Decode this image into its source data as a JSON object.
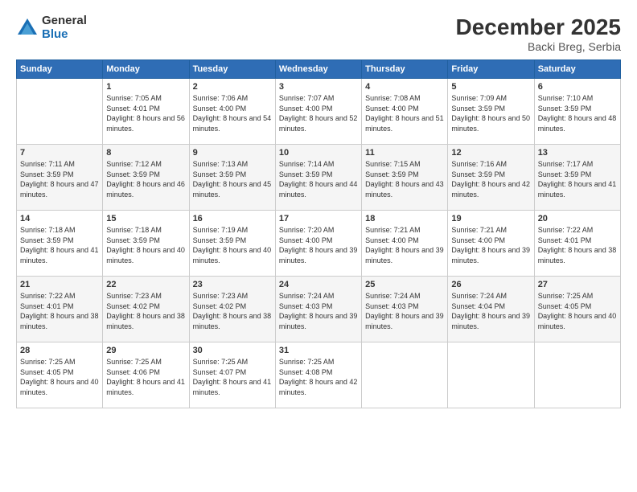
{
  "header": {
    "logo_general": "General",
    "logo_blue": "Blue",
    "title": "December 2025",
    "location": "Backi Breg, Serbia"
  },
  "days_of_week": [
    "Sunday",
    "Monday",
    "Tuesday",
    "Wednesday",
    "Thursday",
    "Friday",
    "Saturday"
  ],
  "weeks": [
    [
      {
        "day": "",
        "empty": true
      },
      {
        "day": "1",
        "sunrise": "Sunrise: 7:05 AM",
        "sunset": "Sunset: 4:01 PM",
        "daylight": "Daylight: 8 hours and 56 minutes."
      },
      {
        "day": "2",
        "sunrise": "Sunrise: 7:06 AM",
        "sunset": "Sunset: 4:00 PM",
        "daylight": "Daylight: 8 hours and 54 minutes."
      },
      {
        "day": "3",
        "sunrise": "Sunrise: 7:07 AM",
        "sunset": "Sunset: 4:00 PM",
        "daylight": "Daylight: 8 hours and 52 minutes."
      },
      {
        "day": "4",
        "sunrise": "Sunrise: 7:08 AM",
        "sunset": "Sunset: 4:00 PM",
        "daylight": "Daylight: 8 hours and 51 minutes."
      },
      {
        "day": "5",
        "sunrise": "Sunrise: 7:09 AM",
        "sunset": "Sunset: 3:59 PM",
        "daylight": "Daylight: 8 hours and 50 minutes."
      },
      {
        "day": "6",
        "sunrise": "Sunrise: 7:10 AM",
        "sunset": "Sunset: 3:59 PM",
        "daylight": "Daylight: 8 hours and 48 minutes."
      }
    ],
    [
      {
        "day": "7",
        "sunrise": "Sunrise: 7:11 AM",
        "sunset": "Sunset: 3:59 PM",
        "daylight": "Daylight: 8 hours and 47 minutes."
      },
      {
        "day": "8",
        "sunrise": "Sunrise: 7:12 AM",
        "sunset": "Sunset: 3:59 PM",
        "daylight": "Daylight: 8 hours and 46 minutes."
      },
      {
        "day": "9",
        "sunrise": "Sunrise: 7:13 AM",
        "sunset": "Sunset: 3:59 PM",
        "daylight": "Daylight: 8 hours and 45 minutes."
      },
      {
        "day": "10",
        "sunrise": "Sunrise: 7:14 AM",
        "sunset": "Sunset: 3:59 PM",
        "daylight": "Daylight: 8 hours and 44 minutes."
      },
      {
        "day": "11",
        "sunrise": "Sunrise: 7:15 AM",
        "sunset": "Sunset: 3:59 PM",
        "daylight": "Daylight: 8 hours and 43 minutes."
      },
      {
        "day": "12",
        "sunrise": "Sunrise: 7:16 AM",
        "sunset": "Sunset: 3:59 PM",
        "daylight": "Daylight: 8 hours and 42 minutes."
      },
      {
        "day": "13",
        "sunrise": "Sunrise: 7:17 AM",
        "sunset": "Sunset: 3:59 PM",
        "daylight": "Daylight: 8 hours and 41 minutes."
      }
    ],
    [
      {
        "day": "14",
        "sunrise": "Sunrise: 7:18 AM",
        "sunset": "Sunset: 3:59 PM",
        "daylight": "Daylight: 8 hours and 41 minutes."
      },
      {
        "day": "15",
        "sunrise": "Sunrise: 7:18 AM",
        "sunset": "Sunset: 3:59 PM",
        "daylight": "Daylight: 8 hours and 40 minutes."
      },
      {
        "day": "16",
        "sunrise": "Sunrise: 7:19 AM",
        "sunset": "Sunset: 3:59 PM",
        "daylight": "Daylight: 8 hours and 40 minutes."
      },
      {
        "day": "17",
        "sunrise": "Sunrise: 7:20 AM",
        "sunset": "Sunset: 4:00 PM",
        "daylight": "Daylight: 8 hours and 39 minutes."
      },
      {
        "day": "18",
        "sunrise": "Sunrise: 7:21 AM",
        "sunset": "Sunset: 4:00 PM",
        "daylight": "Daylight: 8 hours and 39 minutes."
      },
      {
        "day": "19",
        "sunrise": "Sunrise: 7:21 AM",
        "sunset": "Sunset: 4:00 PM",
        "daylight": "Daylight: 8 hours and 39 minutes."
      },
      {
        "day": "20",
        "sunrise": "Sunrise: 7:22 AM",
        "sunset": "Sunset: 4:01 PM",
        "daylight": "Daylight: 8 hours and 38 minutes."
      }
    ],
    [
      {
        "day": "21",
        "sunrise": "Sunrise: 7:22 AM",
        "sunset": "Sunset: 4:01 PM",
        "daylight": "Daylight: 8 hours and 38 minutes."
      },
      {
        "day": "22",
        "sunrise": "Sunrise: 7:23 AM",
        "sunset": "Sunset: 4:02 PM",
        "daylight": "Daylight: 8 hours and 38 minutes."
      },
      {
        "day": "23",
        "sunrise": "Sunrise: 7:23 AM",
        "sunset": "Sunset: 4:02 PM",
        "daylight": "Daylight: 8 hours and 38 minutes."
      },
      {
        "day": "24",
        "sunrise": "Sunrise: 7:24 AM",
        "sunset": "Sunset: 4:03 PM",
        "daylight": "Daylight: 8 hours and 39 minutes."
      },
      {
        "day": "25",
        "sunrise": "Sunrise: 7:24 AM",
        "sunset": "Sunset: 4:03 PM",
        "daylight": "Daylight: 8 hours and 39 minutes."
      },
      {
        "day": "26",
        "sunrise": "Sunrise: 7:24 AM",
        "sunset": "Sunset: 4:04 PM",
        "daylight": "Daylight: 8 hours and 39 minutes."
      },
      {
        "day": "27",
        "sunrise": "Sunrise: 7:25 AM",
        "sunset": "Sunset: 4:05 PM",
        "daylight": "Daylight: 8 hours and 40 minutes."
      }
    ],
    [
      {
        "day": "28",
        "sunrise": "Sunrise: 7:25 AM",
        "sunset": "Sunset: 4:05 PM",
        "daylight": "Daylight: 8 hours and 40 minutes."
      },
      {
        "day": "29",
        "sunrise": "Sunrise: 7:25 AM",
        "sunset": "Sunset: 4:06 PM",
        "daylight": "Daylight: 8 hours and 41 minutes."
      },
      {
        "day": "30",
        "sunrise": "Sunrise: 7:25 AM",
        "sunset": "Sunset: 4:07 PM",
        "daylight": "Daylight: 8 hours and 41 minutes."
      },
      {
        "day": "31",
        "sunrise": "Sunrise: 7:25 AM",
        "sunset": "Sunset: 4:08 PM",
        "daylight": "Daylight: 8 hours and 42 minutes."
      },
      {
        "day": "",
        "empty": true
      },
      {
        "day": "",
        "empty": true
      },
      {
        "day": "",
        "empty": true
      }
    ]
  ]
}
